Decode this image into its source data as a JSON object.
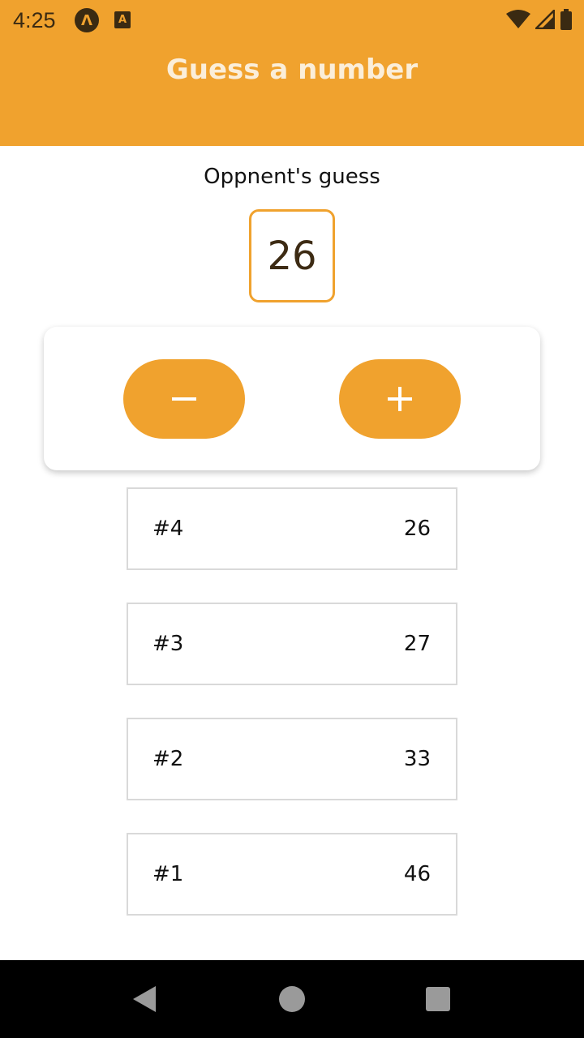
{
  "status_bar": {
    "time": "4:25",
    "app_icon_letter": "Λ",
    "notification_icon_letter": "A",
    "icons": [
      "wifi-icon",
      "cellular-signal-icon",
      "battery-icon"
    ]
  },
  "header": {
    "title": "Guess a number",
    "background_color": "#F0A22E"
  },
  "main": {
    "subtitle": "Oppnent's guess",
    "current_guess": "26"
  },
  "controls": {
    "lower_icon": "minus-icon",
    "higher_icon": "plus-icon"
  },
  "history": [
    {
      "round": "#4",
      "value": "26"
    },
    {
      "round": "#3",
      "value": "27"
    },
    {
      "round": "#2",
      "value": "33"
    },
    {
      "round": "#1",
      "value": "46"
    }
  ],
  "nav_bar": {
    "icons": [
      "back-icon",
      "home-icon",
      "recents-icon"
    ]
  }
}
